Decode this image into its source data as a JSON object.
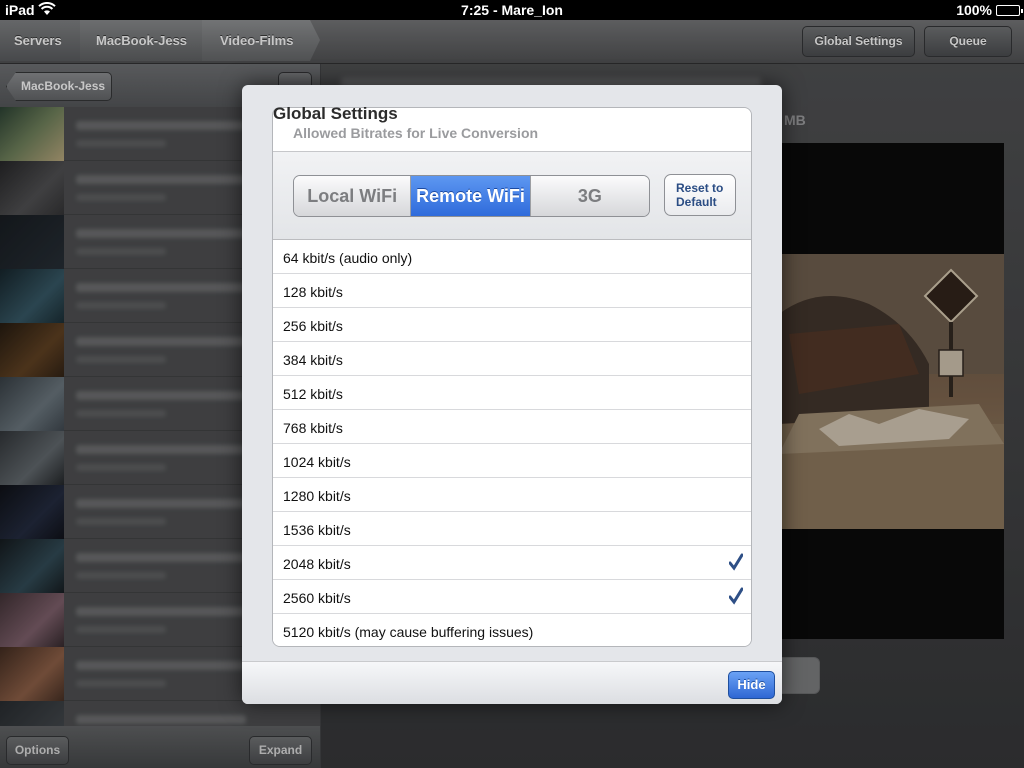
{
  "status_bar": {
    "device": "iPad",
    "clock": "7:25 - Mare_Ion",
    "battery": "100%"
  },
  "breadcrumb": [
    "Servers",
    "MacBook-Jess",
    "Video-Films"
  ],
  "toolbar": {
    "global_settings_label": "Global Settings",
    "queue_label": "Queue"
  },
  "sidebar": {
    "back_label": "MacBook-Jess",
    "options_label": "Options",
    "expand_label": "Expand"
  },
  "detail": {
    "size_fragment": "MB"
  },
  "modal": {
    "title": "Global Settings",
    "section_label": "Allowed Bitrates for Live Conversion",
    "segments": [
      "Local WiFi",
      "Remote WiFi",
      "3G"
    ],
    "selected_segment": "Remote WiFi",
    "reset_label": "Reset to\nDefault",
    "hide_label": "Hide",
    "check_color": "#2e4f86",
    "accent_color": "#3b78e0",
    "rates": [
      {
        "label": "64 kbit/s (audio only)",
        "checked": false
      },
      {
        "label": "128 kbit/s",
        "checked": false
      },
      {
        "label": "256 kbit/s",
        "checked": false
      },
      {
        "label": "384 kbit/s",
        "checked": false
      },
      {
        "label": "512 kbit/s",
        "checked": false
      },
      {
        "label": "768 kbit/s",
        "checked": false
      },
      {
        "label": "1024 kbit/s",
        "checked": false
      },
      {
        "label": "1280 kbit/s",
        "checked": false
      },
      {
        "label": "1536 kbit/s",
        "checked": false
      },
      {
        "label": "2048 kbit/s",
        "checked": true
      },
      {
        "label": "2560 kbit/s",
        "checked": true
      },
      {
        "label": "5120 kbit/s (may cause buffering issues)",
        "checked": false
      }
    ]
  }
}
